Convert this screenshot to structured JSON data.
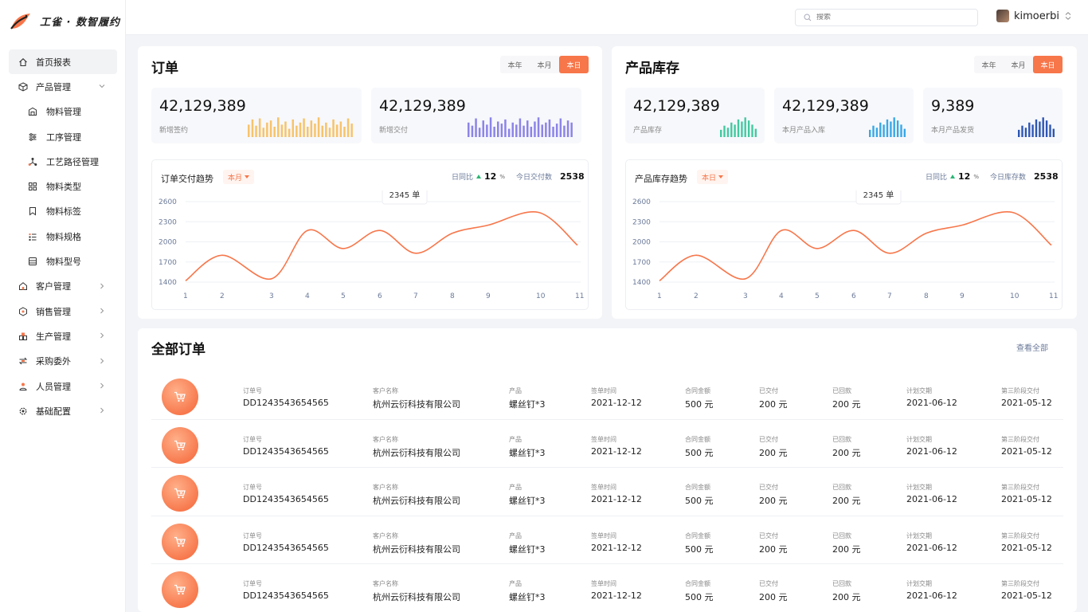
{
  "brand": {
    "name": "工雀 · 数智履约"
  },
  "colors": {
    "accent": "#f7764a",
    "bar_yellow": "#f7c36b",
    "bar_purple": "#8c84e8",
    "bar_green": "#43c9a0",
    "bar_blue": "#38a7e6",
    "bar_navy": "#2d56b5"
  },
  "sidebar": {
    "items": [
      {
        "label": "首页报表",
        "icon": "home-icon",
        "active": true
      },
      {
        "label": "产品管理",
        "icon": "cube-icon",
        "expanded": true,
        "children": [
          {
            "label": "物料管理",
            "icon": "building-icon"
          },
          {
            "label": "工序管理",
            "icon": "sliders-icon"
          },
          {
            "label": "工艺路径管理",
            "icon": "nodes-icon"
          },
          {
            "label": "物料类型",
            "icon": "grid-icon"
          },
          {
            "label": "物料标签",
            "icon": "bookmark-icon"
          },
          {
            "label": "物料规格",
            "icon": "list-icon"
          },
          {
            "label": "物料型号",
            "icon": "card-icon"
          }
        ]
      },
      {
        "label": "客户管理",
        "icon": "house-icon"
      },
      {
        "label": "销售管理",
        "icon": "hexagon-icon"
      },
      {
        "label": "生产管理",
        "icon": "factory-icon"
      },
      {
        "label": "采购委外",
        "icon": "transfer-icon"
      },
      {
        "label": "人员管理",
        "icon": "person-icon"
      },
      {
        "label": "基础配置",
        "icon": "gear-icon"
      }
    ]
  },
  "header": {
    "search_placeholder": "搜索",
    "username": "kimoerbi"
  },
  "orders_card": {
    "title": "订单",
    "ranges": [
      "本年",
      "本月",
      "本日"
    ],
    "selected_range": "本日",
    "stats": [
      {
        "value": "42,129,389",
        "label": "新增签约"
      },
      {
        "value": "42,129,389",
        "label": "新增交付"
      }
    ],
    "trend": {
      "title": "订单交付趋势",
      "period": "本月",
      "compare_label": "日同比",
      "compare_value": "12",
      "compare_unit": "%",
      "today_label": "今日交付数",
      "today_value": "2538",
      "tooltip": "2345 单"
    }
  },
  "inventory_card": {
    "title": "产品库存",
    "ranges": [
      "本年",
      "本月",
      "本日"
    ],
    "selected_range": "本日",
    "stats": [
      {
        "value": "42,129,389",
        "label": "产品库存"
      },
      {
        "value": "42,129,389",
        "label": "本月产品入库"
      },
      {
        "value": "9,389",
        "label": "本月产品发货"
      }
    ],
    "trend": {
      "title": "产品库存趋势",
      "period": "本日",
      "compare_label": "日同比",
      "compare_value": "12",
      "compare_unit": "%",
      "today_label": "今日库存数",
      "today_value": "2538",
      "tooltip": "2345 单"
    }
  },
  "chart_data": [
    {
      "type": "line",
      "title": "订单交付趋势",
      "x": [
        1,
        2,
        3,
        4,
        5,
        6,
        7,
        8,
        9,
        10,
        11
      ],
      "y_tick_labels": [
        "2600",
        "2300",
        "2000",
        "1700",
        "1400"
      ],
      "values": [
        1420,
        1800,
        1450,
        2170,
        1900,
        2170,
        1830,
        2130,
        2250,
        2440,
        1950
      ],
      "ylim": [
        1400,
        2600
      ]
    },
    {
      "type": "line",
      "title": "产品库存趋势",
      "x": [
        1,
        2,
        3,
        4,
        5,
        6,
        7,
        8,
        9,
        10,
        11
      ],
      "y_tick_labels": [
        "2600",
        "2300",
        "2000",
        "1700",
        "1400"
      ],
      "values": [
        1420,
        1800,
        1450,
        2170,
        1900,
        2170,
        1830,
        2130,
        2250,
        2440,
        1950
      ],
      "ylim": [
        1400,
        2600
      ]
    },
    {
      "type": "bar",
      "series": [
        {
          "values": [
            0.6,
            0.85,
            0.55,
            0.9,
            0.45,
            0.7,
            0.8,
            0.5,
            0.95,
            0.6,
            0.75,
            0.4,
            0.85,
            0.55,
            0.7,
            0.9,
            0.5,
            0.8,
            0.65,
            0.95,
            0.55,
            0.7,
            0.45,
            0.85,
            0.6,
            0.75,
            0.5,
            0.9,
            0.65
          ]
        }
      ]
    },
    {
      "type": "bar",
      "series": [
        {
          "values": [
            0.7,
            0.55,
            0.9,
            0.45,
            0.8,
            0.6,
            0.95,
            0.5,
            0.75,
            0.65,
            0.85,
            0.4,
            0.7,
            0.6,
            0.9,
            0.55,
            0.8,
            0.5,
            0.75,
            0.95,
            0.6,
            0.7,
            0.85,
            0.5,
            0.65,
            0.9,
            0.55,
            0.8,
            0.7
          ]
        }
      ]
    },
    {
      "type": "bar",
      "series": [
        {
          "values": [
            0.35,
            0.55,
            0.45,
            0.7,
            0.6,
            0.85,
            0.75,
            0.95,
            0.8,
            0.6,
            0.4
          ]
        }
      ]
    },
    {
      "type": "bar",
      "series": [
        {
          "values": [
            0.35,
            0.55,
            0.45,
            0.7,
            0.6,
            0.85,
            0.75,
            0.95,
            0.8,
            0.6,
            0.4
          ]
        }
      ]
    },
    {
      "type": "bar",
      "series": [
        {
          "values": [
            0.35,
            0.55,
            0.45,
            0.7,
            0.6,
            0.85,
            0.75,
            0.95,
            0.8,
            0.6,
            0.4
          ]
        }
      ]
    }
  ],
  "all_orders": {
    "title": "全部订单",
    "view_all": "查看全部",
    "columns": [
      "订单号",
      "客户名称",
      "产品",
      "签单时间",
      "合同金额",
      "已交付",
      "已回款",
      "计划交期",
      "第三阶段交付"
    ],
    "rows": [
      [
        "DD1243543654565",
        "杭州云衍科技有限公司",
        "螺丝钉*3",
        "2021-12-12",
        "500 元",
        "200 元",
        "200 元",
        "2021-06-12",
        "2021-05-12"
      ],
      [
        "DD1243543654565",
        "杭州云衍科技有限公司",
        "螺丝钉*3",
        "2021-12-12",
        "500 元",
        "200 元",
        "200 元",
        "2021-06-12",
        "2021-05-12"
      ],
      [
        "DD1243543654565",
        "杭州云衍科技有限公司",
        "螺丝钉*3",
        "2021-12-12",
        "500 元",
        "200 元",
        "200 元",
        "2021-06-12",
        "2021-05-12"
      ],
      [
        "DD1243543654565",
        "杭州云衍科技有限公司",
        "螺丝钉*3",
        "2021-12-12",
        "500 元",
        "200 元",
        "200 元",
        "2021-06-12",
        "2021-05-12"
      ],
      [
        "DD1243543654565",
        "杭州云衍科技有限公司",
        "螺丝钉*3",
        "2021-12-12",
        "500 元",
        "200 元",
        "200 元",
        "2021-06-12",
        "2021-05-12"
      ]
    ]
  }
}
